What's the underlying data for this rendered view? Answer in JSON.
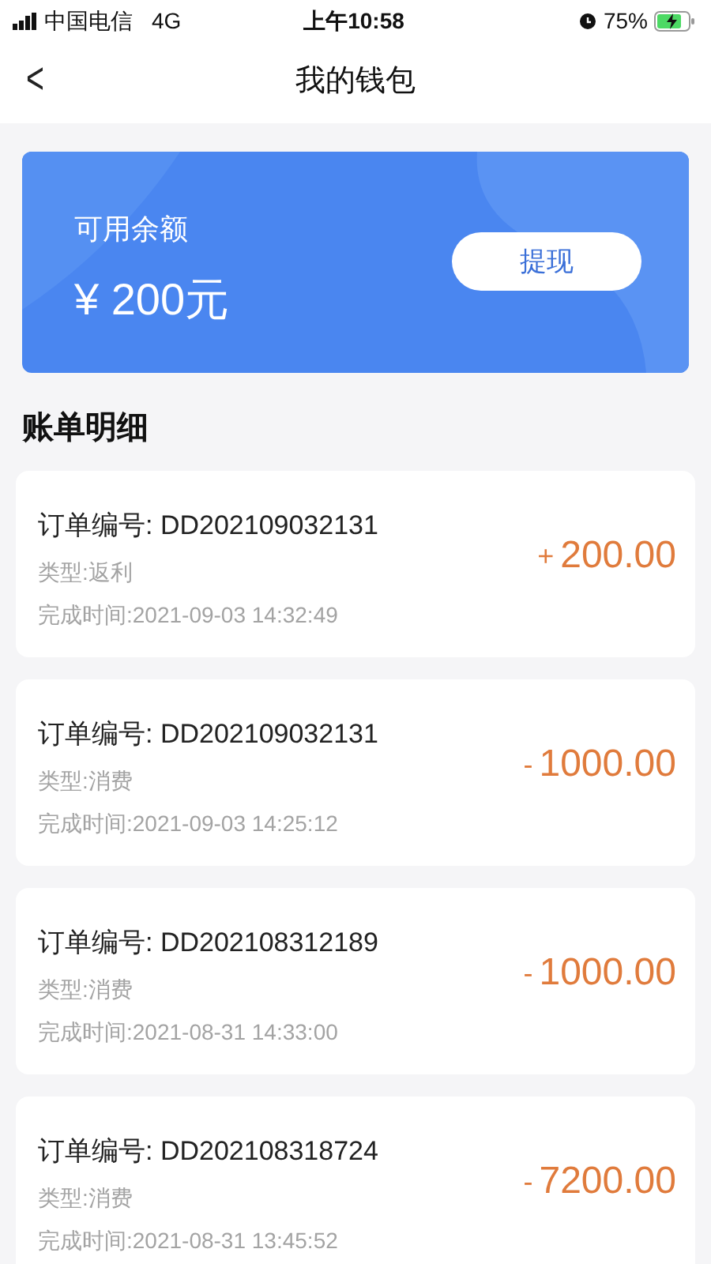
{
  "status_bar": {
    "carrier": "中国电信",
    "network": "4G",
    "time": "上午10:58",
    "battery": "75%"
  },
  "nav": {
    "back": "<",
    "title": "我的钱包"
  },
  "balance": {
    "label": "可用余额",
    "amount": "¥ 200元",
    "button": "提现"
  },
  "section_title": "账单明细",
  "bills": [
    {
      "order": "订单编号: DD202109032131",
      "type": "类型:返利",
      "time": "完成时间:2021-09-03 14:32:49",
      "sign": "+",
      "amount": "200.00"
    },
    {
      "order": "订单编号: DD202109032131",
      "type": "类型:消费",
      "time": "完成时间:2021-09-03 14:25:12",
      "sign": "-",
      "amount": "1000.00"
    },
    {
      "order": "订单编号: DD202108312189",
      "type": "类型:消费",
      "time": "完成时间:2021-08-31 14:33:00",
      "sign": "-",
      "amount": "1000.00"
    },
    {
      "order": "订单编号: DD202108318724",
      "type": "类型:消费",
      "time": "完成时间:2021-08-31 13:45:52",
      "sign": "-",
      "amount": "7200.00"
    }
  ]
}
